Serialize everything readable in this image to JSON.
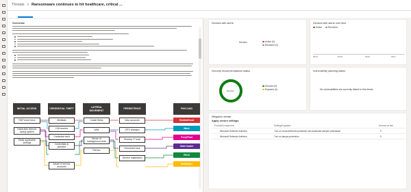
{
  "breadcrumb": {
    "root": "Threats",
    "separator": ">",
    "current": "Ransomware continues to hit healthcare, critical ..."
  },
  "overview": {
    "title": "Overview"
  },
  "diagram": {
    "columns": [
      "INITIAL ACCESS",
      "CREDENTIAL THEFT",
      "LATERAL MOVEMENT",
      "PERSISTENCE",
      "PAYLOAD"
    ],
    "initial_access": [
      "RDP brute force",
      "Vulnerable internet-facing system",
      "Weak application settings"
    ],
    "credential_theft": [
      "Mimikatz",
      "LSA secrets",
      "Credential vault",
      "Credentials in plaintext",
      "Abuse of service accounts"
    ],
    "lateral_movement": [
      "Cobalt Strike",
      "WMI",
      "Abuse of management tools",
      "PsExec"
    ],
    "persistence": [
      "New accounts",
      "GPO changes",
      "Shadow IT tools",
      "Scheduled task",
      "Service registration"
    ],
    "payload": [
      {
        "label": "RobbinHood",
        "color": "#d13438"
      },
      {
        "label": "Maze",
        "color": "#0099bc"
      },
      {
        "label": "PonyFinal",
        "color": "#e3008c"
      },
      {
        "label": "Vatet loader",
        "color": "#5c2e91"
      },
      {
        "label": "REvil",
        "color": "#10893e"
      },
      {
        "label": "NetWalker",
        "color": "#ffb900"
      }
    ]
  },
  "cards": {
    "devices_alerts": {
      "title": "Devices with alerts",
      "center_label": "Devices",
      "legend": [
        {
          "label": "Active (0)",
          "color": "#d13438"
        },
        {
          "label": "Resolved (0)",
          "color": "#8a8886"
        }
      ]
    },
    "alerts_over_time": {
      "title": "Devices with alerts over time",
      "legend": [
        {
          "label": "Active",
          "color": "#d13438"
        },
        {
          "label": "Resolved",
          "color": "#8a8886"
        }
      ],
      "x_ticks": [
        "05/31",
        "06/03",
        "06/10",
        "06/17"
      ]
    },
    "security_recs": {
      "title": "Security recommendations status",
      "center_label": "Devices",
      "legend": [
        {
          "label": "Secured (0)",
          "color": "#107c10"
        },
        {
          "label": "Exposed (0)",
          "color": "#ffb900"
        }
      ],
      "ring_color": "#107c10"
    },
    "vuln_patching": {
      "title": "Vulnerability patching status",
      "message": "No vulnerabilities are currently linked to this threat"
    },
    "mitigation": {
      "title": "Mitigation details",
      "subtitle": "Apply secure settings",
      "headers": [
        "Product/Component",
        "Settings/Updates",
        "Devices at risk"
      ],
      "rows": [
        [
          "Microsoft Defender Antivirus",
          "Turn on cloud-delivered protection and automatic sample submission",
          "0"
        ],
        [
          "Microsoft Defender Antivirus",
          "Turn on tamper protection",
          "0"
        ]
      ]
    }
  }
}
